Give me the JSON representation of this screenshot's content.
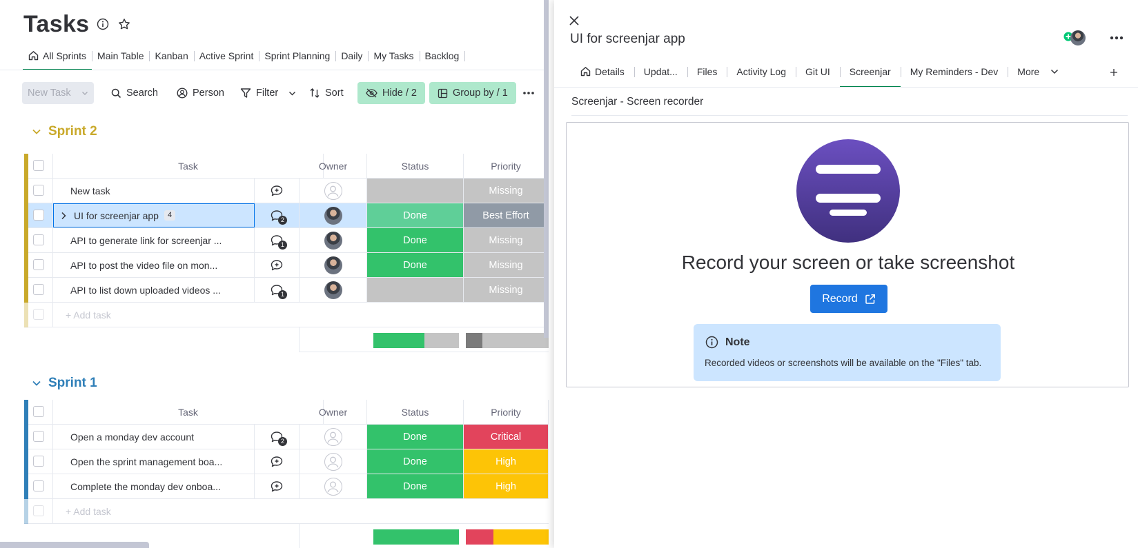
{
  "board": {
    "title": "Tasks",
    "views": [
      "All Sprints",
      "Main Table",
      "Kanban",
      "Active Sprint",
      "Sprint Planning",
      "Daily",
      "My Tasks",
      "Backlog"
    ],
    "toolbar": {
      "new_task": "New Task",
      "search": "Search",
      "person": "Person",
      "filter": "Filter",
      "sort": "Sort",
      "hide": "Hide / 2",
      "group_by": "Group by / 1"
    },
    "columns": {
      "task": "Task",
      "owner": "Owner",
      "status": "Status",
      "priority": "Priority"
    },
    "add_task": "+ Add task",
    "groups": [
      {
        "name": "Sprint 2",
        "color": "#c9a92a",
        "rows": [
          {
            "task": "New task",
            "updates": "",
            "owner": "empty",
            "status": "",
            "status_color": "#c4c4c4",
            "priority": "Missing",
            "priority_color": "#c4c4c4"
          },
          {
            "task": "UI for screenjar app",
            "subitems": "4",
            "updates": "2",
            "owner": "photo",
            "status": "Done",
            "status_color": "#5fcf98",
            "priority": "Best Effort",
            "priority_color": "#909aa6",
            "selected": true
          },
          {
            "task": "API to generate link for screenjar ...",
            "updates": "1",
            "owner": "photo",
            "status": "Done",
            "status_color": "#33c26b",
            "priority": "Missing",
            "priority_color": "#c4c4c4"
          },
          {
            "task": "API to post the video file on mon...",
            "updates": "",
            "owner": "photo",
            "status": "Done",
            "status_color": "#33c26b",
            "priority": "Missing",
            "priority_color": "#c4c4c4"
          },
          {
            "task": "API to list down uploaded videos ...",
            "updates": "1",
            "owner": "photo",
            "status": "",
            "status_color": "#c4c4c4",
            "priority": "Missing",
            "priority_color": "#c4c4c4"
          }
        ],
        "status_summary": [
          {
            "color": "#33c26b",
            "share": 0.6
          },
          {
            "color": "#c4c4c4",
            "share": 0.4
          }
        ],
        "priority_summary": [
          {
            "color": "#7b7b7b",
            "share": 0.2
          },
          {
            "color": "#c4c4c4",
            "share": 0.8
          }
        ]
      },
      {
        "name": "Sprint 1",
        "color": "#2f7fb8",
        "rows": [
          {
            "task": "Open a monday dev account",
            "updates": "2",
            "owner": "empty",
            "status": "Done",
            "status_color": "#33c26b",
            "priority": "Critical",
            "priority_color": "#e2445c"
          },
          {
            "task": "Open the sprint management boa...",
            "updates": "",
            "owner": "empty",
            "status": "Done",
            "status_color": "#33c26b",
            "priority": "High",
            "priority_color": "#fdc406"
          },
          {
            "task": "Complete the monday dev onboa...",
            "updates": "",
            "owner": "empty",
            "status": "Done",
            "status_color": "#33c26b",
            "priority": "High",
            "priority_color": "#fdc406"
          }
        ],
        "status_summary": [
          {
            "color": "#33c26b",
            "share": 1.0
          }
        ],
        "priority_summary": [
          {
            "color": "#e2445c",
            "share": 0.33
          },
          {
            "color": "#fdc406",
            "share": 0.67
          }
        ]
      }
    ]
  },
  "panel": {
    "title": "UI for screenjar app",
    "tabs": [
      "Details",
      "Updat...",
      "Files",
      "Activity Log",
      "Git UI",
      "Screenjar",
      "My Reminders - Dev",
      "More"
    ],
    "active_tab": "Screenjar",
    "app_name": "Screenjar - Screen recorder",
    "headline": "Record your screen or take screenshot",
    "record_button": "Record",
    "note_title": "Note",
    "note_text": "Recorded videos or screenshots will be available on the \"Files\" tab."
  }
}
